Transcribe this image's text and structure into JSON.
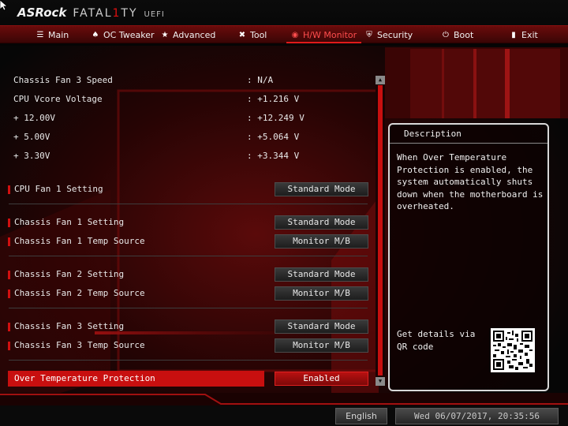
{
  "header": {
    "brand": "ASRock",
    "product_a": "FATAL",
    "product_one": "1",
    "product_b": "TY",
    "uefi": "UEFI"
  },
  "nav": {
    "items": [
      {
        "label": "Main",
        "icon": "menu-icon"
      },
      {
        "label": "OC Tweaker",
        "icon": "rocket-icon"
      },
      {
        "label": "Advanced",
        "icon": "star-icon"
      },
      {
        "label": "Tool",
        "icon": "wrench-icon"
      },
      {
        "label": "H/W Monitor",
        "icon": "monitor-icon"
      },
      {
        "label": "Security",
        "icon": "shield-icon"
      },
      {
        "label": "Boot",
        "icon": "power-icon"
      },
      {
        "label": "Exit",
        "icon": "exit-door-icon"
      }
    ],
    "active": "H/W Monitor"
  },
  "readings": [
    {
      "label": "Chassis Fan 3 Speed",
      "value": ": N/A"
    },
    {
      "label": "CPU Vcore Voltage",
      "value": ": +1.216 V"
    },
    {
      "label": "+ 12.00V",
      "value": ": +12.249 V"
    },
    {
      "label": "+ 5.00V",
      "value": ": +5.064 V"
    },
    {
      "label": "+ 3.30V",
      "value": ": +3.344 V"
    }
  ],
  "settings": [
    {
      "label": "CPU Fan 1 Setting",
      "value": "Standard Mode"
    },
    {
      "label": "Chassis Fan 1 Setting",
      "value": "Standard Mode"
    },
    {
      "label": "Chassis Fan 1 Temp Source",
      "value": "Monitor M/B"
    },
    {
      "label": "Chassis Fan 2 Setting",
      "value": "Standard Mode"
    },
    {
      "label": "Chassis Fan 2 Temp Source",
      "value": "Monitor M/B"
    },
    {
      "label": "Chassis Fan 3 Setting",
      "value": "Standard Mode"
    },
    {
      "label": "Chassis Fan 3 Temp Source",
      "value": "Monitor M/B"
    },
    {
      "label": "Over Temperature Protection",
      "value": "Enabled"
    }
  ],
  "selected_setting": "Over Temperature Protection",
  "description": {
    "title": "Description",
    "text": "When Over Temperature Protection is enabled, the system automatically shuts down when the motherboard is overheated.",
    "qr_text": "Get details via QR code"
  },
  "footer": {
    "language": "English",
    "datetime": "Wed 06/07/2017, 20:35:56"
  },
  "colors": {
    "accent": "#c80f0f",
    "nav_bg": "#5a0909",
    "panel_border": "#d8d8d8"
  }
}
